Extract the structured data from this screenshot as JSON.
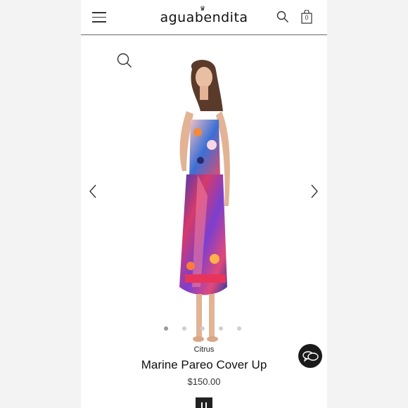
{
  "header": {
    "logo_text": "aguabendita",
    "bag_count": "0",
    "menu_icon": "hamburger-menu-icon",
    "search_icon": "search-icon",
    "bag_icon": "shopping-bag-icon"
  },
  "gallery": {
    "zoom_icon": "zoom-icon",
    "prev_icon": "chevron-left-icon",
    "next_icon": "chevron-right-icon",
    "slide_count": 5,
    "active_slide": 1
  },
  "product": {
    "collection": "Citrus",
    "name": "Marine Pareo Cover Up",
    "price": "$150.00"
  },
  "colors": {
    "accent": "#111111",
    "background": "#ffffff"
  }
}
